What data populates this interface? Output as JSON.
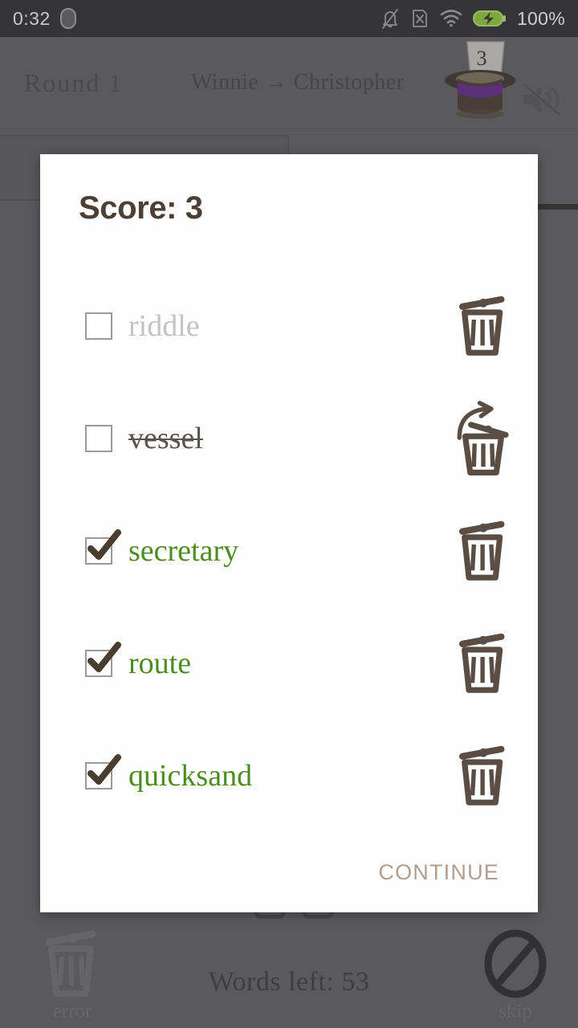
{
  "status_bar": {
    "clock": "0:32",
    "battery_percent": "100%",
    "icons": [
      "recording-oval-icon",
      "bell-muted-icon",
      "sim-card-missing-icon",
      "wifi-icon",
      "battery-charging-icon"
    ]
  },
  "game": {
    "round_label": "Round 1",
    "turn_label": "Winnie → Christopher",
    "hat_card_number": "3",
    "mute_icon": "speaker-muted-icon",
    "words_left_label": "Words left: 53",
    "error_caption": "error",
    "skip_caption": "skip",
    "error_icon": "trash-icon",
    "skip_icon": "no-entry-icon"
  },
  "dialog": {
    "title": "Score: 3",
    "continue_label": "CONTINUE",
    "words": [
      {
        "text": "riddle",
        "state": "pale",
        "checked": false,
        "action_icon": "trash-icon"
      },
      {
        "text": "vessel",
        "state": "struck",
        "checked": false,
        "action_icon": "restore-icon"
      },
      {
        "text": "secretary",
        "state": "green",
        "checked": true,
        "action_icon": "trash-icon"
      },
      {
        "text": "route",
        "state": "green",
        "checked": true,
        "action_icon": "trash-icon"
      },
      {
        "text": "quicksand",
        "state": "green",
        "checked": true,
        "action_icon": "trash-icon"
      }
    ]
  },
  "colors": {
    "status_bar_bg": "#353538",
    "backdrop": "#6a6a6c",
    "dialog_bg": "#fefefe",
    "title_brown": "#4b3f36",
    "word_green": "#4c8c20",
    "word_pale": "#c3c3c3",
    "word_struck": "#5b5350",
    "continue_tan": "#b09f90",
    "icon_brown": "#5a4e44",
    "hat_band_purple": "#6d1f9e",
    "battery_green": "#8bc34a"
  }
}
